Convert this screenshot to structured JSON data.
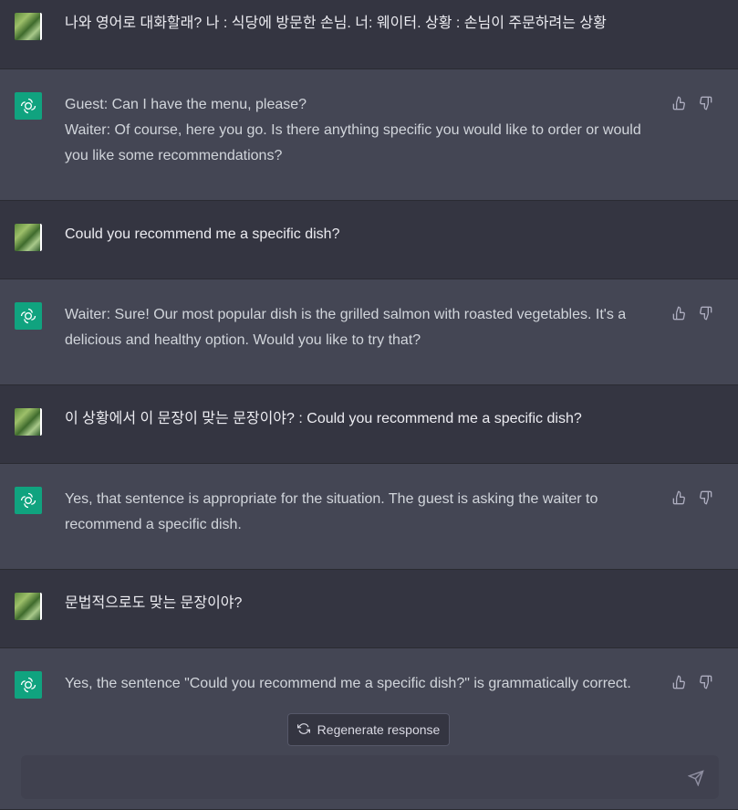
{
  "messages": [
    {
      "role": "user",
      "text": "나와 영어로 대화할래? 나 : 식당에 방문한 손님. 너: 웨이터. 상황 : 손님이 주문하려는 상황"
    },
    {
      "role": "assistant",
      "text": "Guest: Can I have the menu, please?\nWaiter: Of course, here you go. Is there anything specific you would like to order or would you like some recommendations?"
    },
    {
      "role": "user",
      "text": "Could you recommend me a specific dish?"
    },
    {
      "role": "assistant",
      "text": "Waiter: Sure! Our most popular dish is the grilled salmon with roasted vegetables. It's a delicious and healthy option. Would you like to try that?"
    },
    {
      "role": "user",
      "text": "이 상황에서 이 문장이 맞는 문장이야? : Could you recommend me a specific dish?"
    },
    {
      "role": "assistant",
      "text": "Yes, that sentence is appropriate for the situation. The guest is asking the waiter to recommend a specific dish."
    },
    {
      "role": "user",
      "text": "문법적으로도 맞는 문장이야?"
    },
    {
      "role": "assistant",
      "text": "Yes, the sentence \"Could you recommend me a specific dish?\" is grammatically correct."
    }
  ],
  "regenerate_label": "Regenerate response",
  "input": {
    "value": "",
    "placeholder": ""
  },
  "colors": {
    "accent": "#10a37f",
    "user_bg": "#343541",
    "assistant_bg": "#444654"
  },
  "icons": [
    "user-avatar-icon",
    "assistant-logo-icon",
    "thumbs-up-icon",
    "thumbs-down-icon",
    "refresh-icon",
    "send-icon"
  ]
}
